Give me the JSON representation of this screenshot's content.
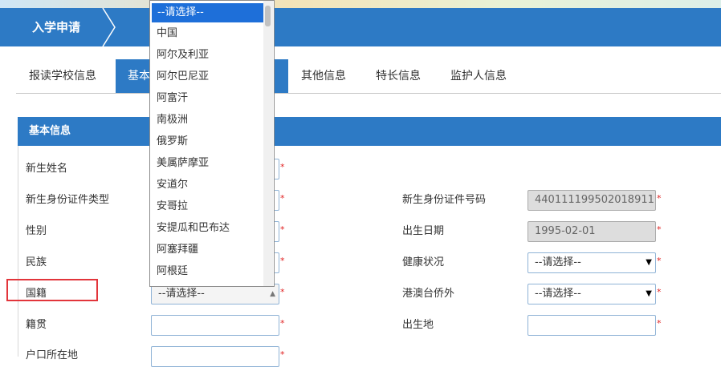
{
  "header": {
    "breadcrumb": "入学申请"
  },
  "tabs": [
    {
      "label": "报读学校信息"
    },
    {
      "label": "基本"
    },
    {
      "label": "其他信息"
    },
    {
      "label": "特长信息"
    },
    {
      "label": "监护人信息"
    }
  ],
  "section": {
    "title": "基本信息"
  },
  "fields": {
    "name_label": "新生姓名",
    "id_type_label": "新生身份证件类型",
    "id_number_label": "新生身份证件号码",
    "id_number_value": "440111199502018911",
    "gender_label": "性别",
    "birthdate_label": "出生日期",
    "birthdate_value": "1995-02-01",
    "ethnicity_label": "民族",
    "health_label": "健康状况",
    "health_value": "--请选择--",
    "nationality_label": "国籍",
    "nationality_value": "--请选择--",
    "overseas_label": "港澳台侨外",
    "overseas_value": "--请选择--",
    "native_place_label": "籍贯",
    "birthplace_label": "出生地",
    "household_label": "户口所在地",
    "required_mark": "*"
  },
  "dropdown": {
    "items": [
      "--请选择--",
      "中国",
      "阿尔及利亚",
      "阿尔巴尼亚",
      "阿富汗",
      "南极洲",
      "俄罗斯",
      "美属萨摩亚",
      "安道尔",
      "安哥拉",
      "安提瓜和巴布达",
      "阿塞拜疆",
      "阿根廷"
    ],
    "selected_index": 0
  },
  "colors": {
    "primary": "#2d7ac5",
    "highlight_box": "#e2353b",
    "required": "#e02020",
    "dropdown_selected": "#1e6fd9"
  }
}
